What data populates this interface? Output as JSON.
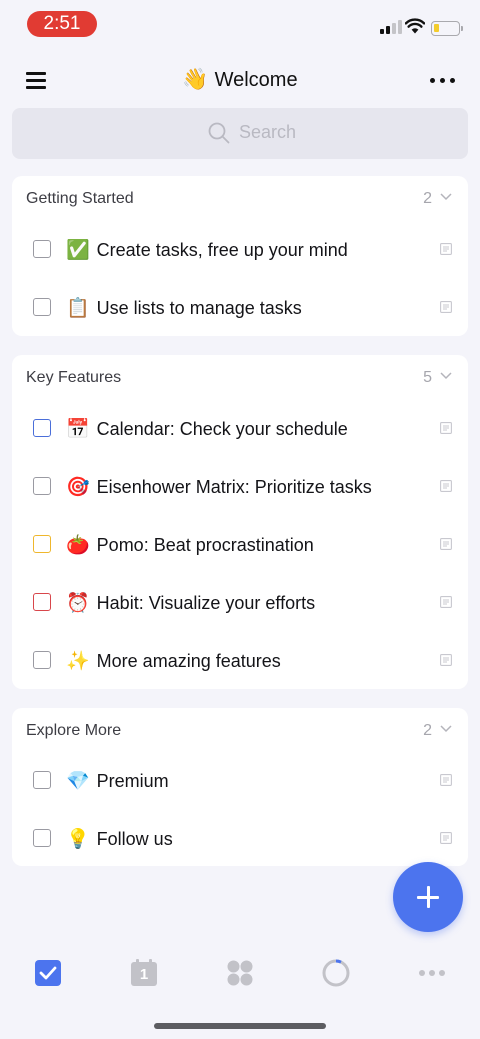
{
  "status_bar": {
    "time": "2:51"
  },
  "header": {
    "title_emoji": "👋",
    "title": "Welcome",
    "menu_icon": "hamburger-menu-icon",
    "more_icon": "more-dots-icon"
  },
  "search": {
    "placeholder": "Search",
    "icon": "search-icon"
  },
  "sections": [
    {
      "title": "Getting Started",
      "count": "2",
      "tasks": [
        {
          "emoji": "✅",
          "title": "Create tasks, free up your mind",
          "checkbox_color": "#9a9aa2"
        },
        {
          "emoji": "📋",
          "title": "Use lists to manage tasks",
          "checkbox_color": "#9a9aa2"
        }
      ]
    },
    {
      "title": "Key Features",
      "count": "5",
      "tasks": [
        {
          "emoji": "📅",
          "title": "Calendar: Check your schedule",
          "checkbox_color": "#4a6ed9"
        },
        {
          "emoji": "🎯",
          "title": "Eisenhower Matrix: Prioritize tasks",
          "checkbox_color": "#9a9aa2"
        },
        {
          "emoji": "🍅",
          "title": "Pomo: Beat procrastination",
          "checkbox_color": "#efb72d"
        },
        {
          "emoji": "⏰",
          "title": "Habit: Visualize your efforts",
          "checkbox_color": "#d8464b"
        },
        {
          "emoji": "✨",
          "title": "More amazing features",
          "checkbox_color": "#9a9aa2"
        }
      ]
    },
    {
      "title": "Explore More",
      "count": "2",
      "tasks": [
        {
          "emoji": "💎",
          "title": "Premium",
          "checkbox_color": "#9a9aa2"
        },
        {
          "emoji": "💡",
          "title": "Follow us",
          "checkbox_color": "#9a9aa2"
        }
      ]
    }
  ],
  "fab": {
    "icon": "plus-icon"
  },
  "bottom_nav": {
    "items": [
      "tasks-icon",
      "calendar-icon",
      "matrix-icon",
      "pomodoro-icon",
      "more-icon"
    ],
    "calendar_day": "1",
    "active_color": "#4c74ee"
  }
}
